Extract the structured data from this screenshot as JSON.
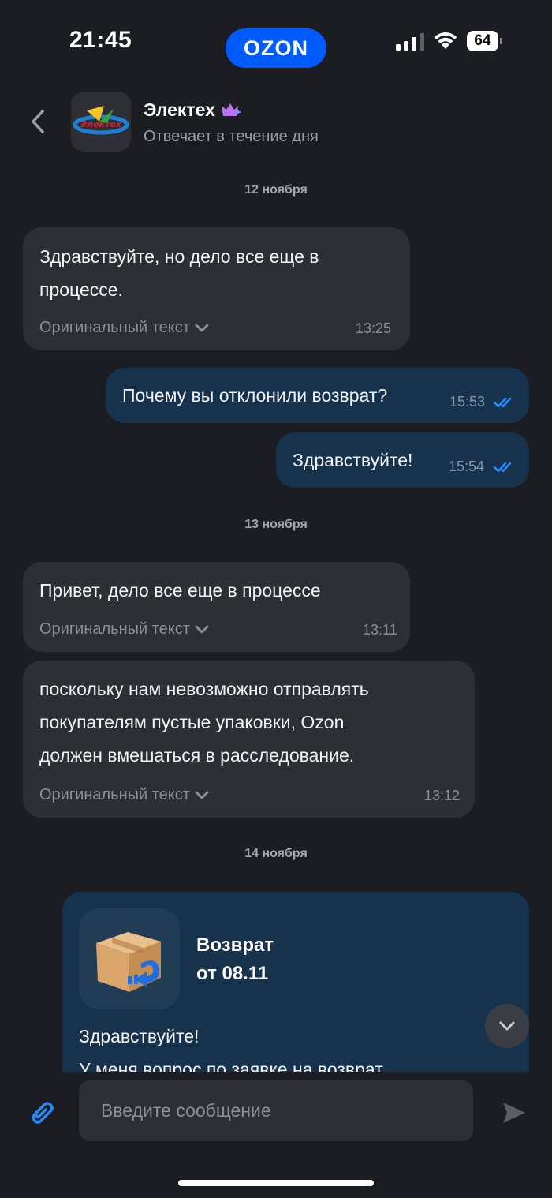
{
  "status_bar": {
    "time": "21:45",
    "brand": "OZON",
    "battery": "64"
  },
  "header": {
    "shop_name": "Электех",
    "subtitle": "Отвечает в течение дня",
    "logo_text": "Электех"
  },
  "dates": [
    "12 ноября",
    "13 ноября",
    "14 ноября"
  ],
  "messages": [
    {
      "direction": "in",
      "text_lines": [
        "Здравствуйте, но дело все еще в",
        "процессе."
      ],
      "original_label": "Оригинальный текст",
      "time": "13:25"
    },
    {
      "direction": "out",
      "text": "Почему вы отклонили возврат?",
      "time": "15:53",
      "read": true
    },
    {
      "direction": "out",
      "text": "Здравствуйте!",
      "time": "15:54",
      "read": true
    },
    {
      "direction": "in",
      "text_lines": [
        "Привет, дело все еще в процессе"
      ],
      "original_label": "Оригинальный текст",
      "time": "13:11"
    },
    {
      "direction": "in",
      "text_lines": [
        "поскольку нам невозможно отправлять",
        "покупателям пустые упаковки, Ozon",
        "должен вмешаться в расследование."
      ],
      "original_label": "Оригинальный текст",
      "time": "13:12"
    }
  ],
  "return_card": {
    "title_line1": "Возврат",
    "title_line2": "от 08.11",
    "greeting": "Здравствуйте!",
    "cut_text": "У меня вопрос по заявке на возврат"
  },
  "composer": {
    "placeholder": "Введите сообщение"
  },
  "colors": {
    "accent": "#005bff",
    "bg": "#1b1d22",
    "incoming": "#2d2f35",
    "outgoing": "#16324c",
    "check": "#2b8cff"
  }
}
